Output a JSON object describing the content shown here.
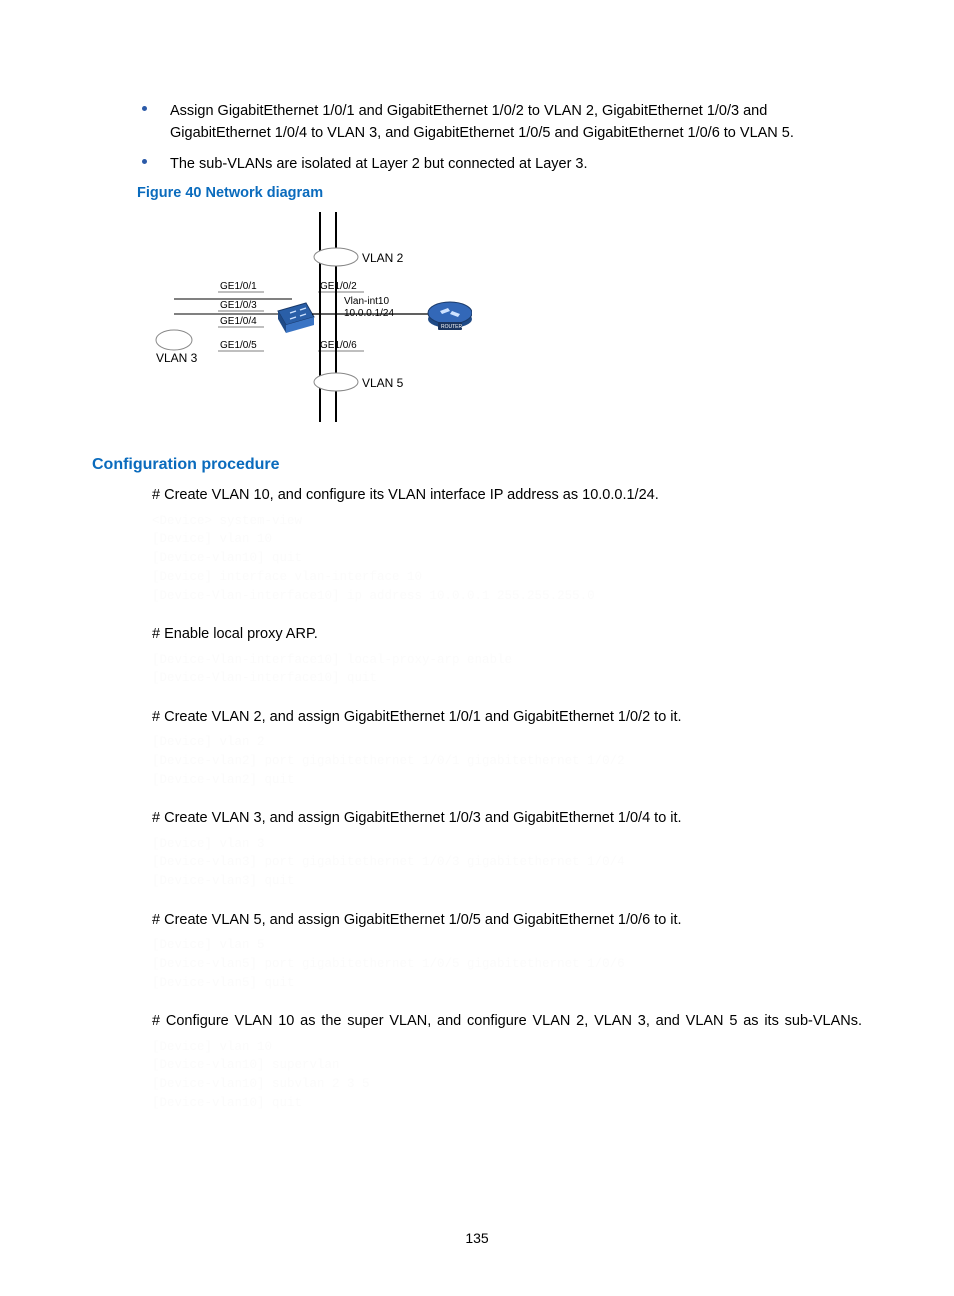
{
  "bullets": [
    "Assign GigabitEthernet 1/0/1 and GigabitEthernet 1/0/2 to VLAN 2, GigabitEthernet 1/0/3 and GigabitEthernet 1/0/4 to VLAN 3, and GigabitEthernet 1/0/5 and GigabitEthernet 1/0/6 to VLAN 5.",
    "The sub-VLANs are isolated at Layer 2 but connected at Layer 3."
  ],
  "figure_caption": "Figure 40 Network diagram",
  "diagram": {
    "vlan2": "VLAN 2",
    "vlan3": "VLAN 3",
    "vlan5": "VLAN 5",
    "ge101": "GE1/0/1",
    "ge102": "GE1/0/2",
    "ge103": "GE1/0/3",
    "ge104": "GE1/0/4",
    "ge105": "GE1/0/5",
    "ge106": "GE1/0/6",
    "vlanint": "Vlan-int10",
    "ip": "10.0.0.1/24",
    "switch_label": "SWITCH",
    "router_label": "ROUTER"
  },
  "section_heading": "Configuration procedure",
  "steps": {
    "s1": "# Create VLAN 10, and configure its VLAN interface IP address as 10.0.0.1/24.",
    "c1": "<Device> system-view\n[Device] vlan 10\n[Device-vlan10] quit\n[Device] interface vlan-interface 10\n[Device-Vlan-interface10] ip address 10.0.0.1 255.255.255.0",
    "s2": "# Enable local proxy ARP.",
    "c2": "[Device-Vlan-interface10] local-proxy-arp enable\n[Device-Vlan-interface10] quit",
    "s3": "# Create VLAN 2, and assign GigabitEthernet 1/0/1 and GigabitEthernet 1/0/2 to it.",
    "c3": "[Device] vlan 2\n[Device-vlan2] port gigabitethernet 1/0/1 gigabitethernet 1/0/2\n[Device-vlan2] quit",
    "s4": "# Create VLAN 3, and assign GigabitEthernet 1/0/3 and GigabitEthernet 1/0/4 to it.",
    "c4": "[Device] vlan 3\n[Device-vlan3] port gigabitethernet 1/0/3 gigabitethernet 1/0/4\n[Device-vlan3] quit",
    "s5": "# Create VLAN 5, and assign GigabitEthernet 1/0/5 and GigabitEthernet 1/0/6 to it.",
    "c5": "[Device] vlan 5\n[Device-vlan5] port gigabitethernet 1/0/5 gigabitethernet 1/0/6\n[Device-vlan5] quit",
    "s6": "# Configure VLAN 10 as the super VLAN, and configure VLAN 2, VLAN 3, and VLAN 5 as its sub-VLANs.",
    "c6": "[Device] vlan 10\n[Device-vlan10] supervlan\n[Device-vlan10] subvlan 2 3 5\n[Device-vlan10] quit"
  },
  "page_number": "135"
}
